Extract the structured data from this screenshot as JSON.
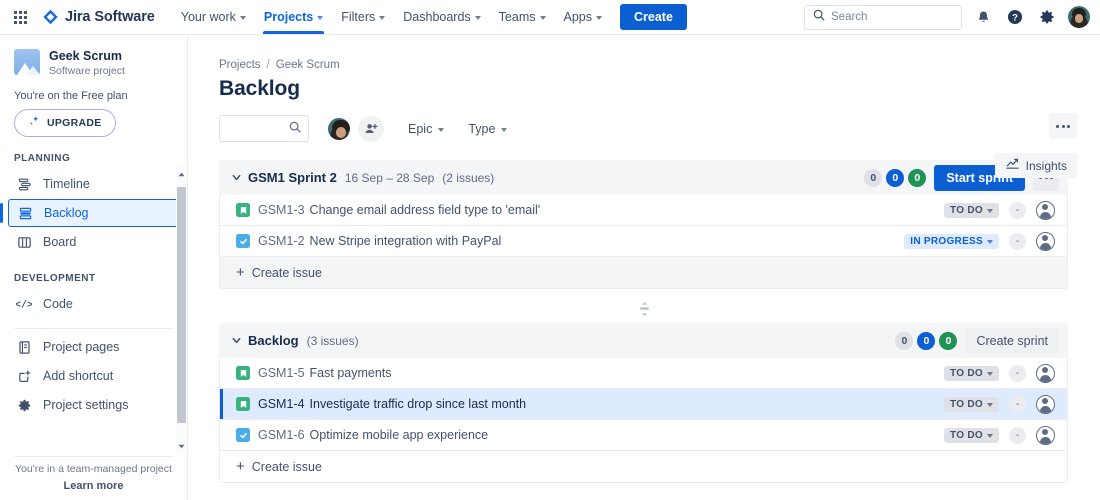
{
  "topnav": {
    "apps_icon": "apps-grid-icon",
    "brand": "Jira Software",
    "items": [
      {
        "label": "Your work",
        "active": false
      },
      {
        "label": "Projects",
        "active": true
      },
      {
        "label": "Filters",
        "active": false
      },
      {
        "label": "Dashboards",
        "active": false
      },
      {
        "label": "Teams",
        "active": false
      },
      {
        "label": "Apps",
        "active": false
      }
    ],
    "create_label": "Create",
    "search_placeholder": "Search",
    "icons": [
      "search-icon",
      "notifications-bell-icon",
      "help-icon",
      "settings-gear-icon",
      "user-avatar"
    ]
  },
  "sidebar": {
    "project_name": "Geek Scrum",
    "project_type": "Software project",
    "plan_text": "You're on the Free plan",
    "upgrade_label": "UPGRADE",
    "sections": [
      {
        "title": "PLANNING",
        "items": [
          {
            "label": "Timeline",
            "icon": "timeline-icon",
            "selected": false
          },
          {
            "label": "Backlog",
            "icon": "backlog-icon",
            "selected": true
          },
          {
            "label": "Board",
            "icon": "board-icon",
            "selected": false
          }
        ]
      },
      {
        "title": "DEVELOPMENT",
        "items": [
          {
            "label": "Code",
            "icon": "code-icon",
            "selected": false
          }
        ]
      }
    ],
    "bottom_items": [
      {
        "label": "Project pages",
        "icon": "page-icon"
      },
      {
        "label": "Add shortcut",
        "icon": "add-shortcut-icon"
      },
      {
        "label": "Project settings",
        "icon": "settings-gear-icon"
      }
    ],
    "footer_note": "You're in a team-managed project",
    "footer_link": "Learn more"
  },
  "main": {
    "breadcrumb": {
      "root": "Projects",
      "sep": "/",
      "current": "Geek Scrum"
    },
    "page_title": "Backlog",
    "more_top_icon": "more-horizontal-icon",
    "insights_label": "Insights",
    "toolbar": {
      "search_placeholder": "",
      "search_icon": "search-icon",
      "add_people_icon": "add-people-icon",
      "filters": [
        {
          "label": "Epic"
        },
        {
          "label": "Type"
        }
      ]
    },
    "panels": [
      {
        "title": "GSM1 Sprint 2",
        "dates": "16 Sep – 28 Sep",
        "count": "(2 issues)",
        "pills": [
          {
            "value": "0",
            "color": "grey"
          },
          {
            "value": "0",
            "color": "blue"
          },
          {
            "value": "0",
            "color": "green"
          }
        ],
        "action_label": "Start sprint",
        "action_style": "primary",
        "has_more_menu": true,
        "issues": [
          {
            "type": "story",
            "key": "GSM1-3",
            "summary": "Change email address field type to 'email'",
            "status": "TO DO",
            "status_style": "todo",
            "estimate": "-",
            "selected": false
          },
          {
            "type": "task",
            "key": "GSM1-2",
            "summary": "New Stripe integration with PayPal",
            "status": "IN PROGRESS",
            "status_style": "inprog",
            "estimate": "-",
            "selected": false
          }
        ],
        "create_issue_label": "Create issue",
        "create_issue_style": "grey"
      },
      {
        "title": "Backlog",
        "dates": "",
        "count": "(3 issues)",
        "pills": [
          {
            "value": "0",
            "color": "grey"
          },
          {
            "value": "0",
            "color": "blue"
          },
          {
            "value": "0",
            "color": "green"
          }
        ],
        "action_label": "Create sprint",
        "action_style": "subtle",
        "has_more_menu": false,
        "issues": [
          {
            "type": "story",
            "key": "GSM1-5",
            "summary": "Fast payments",
            "status": "TO DO",
            "status_style": "todo",
            "estimate": "-",
            "selected": false
          },
          {
            "type": "story",
            "key": "GSM1-4",
            "summary": "Investigate traffic drop since last month",
            "status": "TO DO",
            "status_style": "todo",
            "estimate": "-",
            "selected": true
          },
          {
            "type": "task",
            "key": "GSM1-6",
            "summary": "Optimize mobile app experience",
            "status": "TO DO",
            "status_style": "todo",
            "estimate": "-",
            "selected": false
          }
        ],
        "create_issue_label": "Create issue",
        "create_issue_style": "white"
      }
    ]
  },
  "colors": {
    "brand_blue": "#0c5fd3",
    "link_blue": "#0c66e4",
    "selected_row": "#deebff",
    "story_green": "#36b37e",
    "task_blue": "#4bade8",
    "panel_grey": "#f4f5f7"
  }
}
